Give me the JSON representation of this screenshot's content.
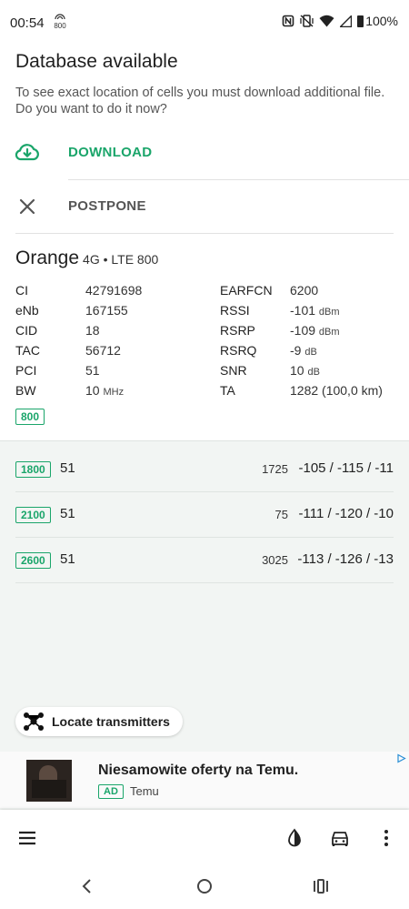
{
  "status_bar": {
    "time": "00:54",
    "band_badge_text": "800",
    "battery_text": "100%"
  },
  "header": {
    "title": "Database available",
    "description": "To see exact location of cells you must download additional file. Do you want to do it now?"
  },
  "actions": {
    "download_label": "DOWNLOAD",
    "postpone_label": "POSTPONE"
  },
  "cell": {
    "operator": "Orange",
    "technology": "4G • LTE 800",
    "left": [
      {
        "label": "CI",
        "value": "42791698",
        "unit": ""
      },
      {
        "label": "eNb",
        "value": "167155",
        "unit": ""
      },
      {
        "label": "CID",
        "value": "18",
        "unit": ""
      },
      {
        "label": "TAC",
        "value": "56712",
        "unit": ""
      },
      {
        "label": "PCI",
        "value": "51",
        "unit": ""
      },
      {
        "label": "BW",
        "value": "10",
        "unit": "MHz"
      }
    ],
    "right": [
      {
        "label": "EARFCN",
        "value": "6200",
        "unit": ""
      },
      {
        "label": "RSSI",
        "value": "-101",
        "unit": "dBm"
      },
      {
        "label": "RSRP",
        "value": "-109",
        "unit": "dBm"
      },
      {
        "label": "RSRQ",
        "value": "-9",
        "unit": "dB"
      },
      {
        "label": "SNR",
        "value": "10",
        "unit": "dB"
      },
      {
        "label": "TA",
        "value": "1282 (100,0 km)",
        "unit": ""
      }
    ],
    "band_badge": "800"
  },
  "neighbors": [
    {
      "band": "1800",
      "pci": "51",
      "earfcn": "1725",
      "signal": "-105 / -115 / -11"
    },
    {
      "band": "2100",
      "pci": "51",
      "earfcn": "75",
      "signal": "-111 / -120 / -10"
    },
    {
      "band": "2600",
      "pci": "51",
      "earfcn": "3025",
      "signal": "-113 / -126 / -13"
    }
  ],
  "locate_button_label": "Locate transmitters",
  "ad": {
    "title": "Niesamowite oferty na Temu.",
    "tag": "AD",
    "sponsor": "Temu"
  },
  "colors": {
    "accent": "#1aa56a",
    "neighbors_background": "#f2f5f3"
  },
  "icons": {
    "download": "cloud-download-icon",
    "postpone": "close-icon",
    "locate": "network-nodes-icon",
    "menu": "hamburger-menu-icon",
    "theme": "contrast-icon",
    "drive": "car-icon",
    "more": "more-vert-icon"
  }
}
